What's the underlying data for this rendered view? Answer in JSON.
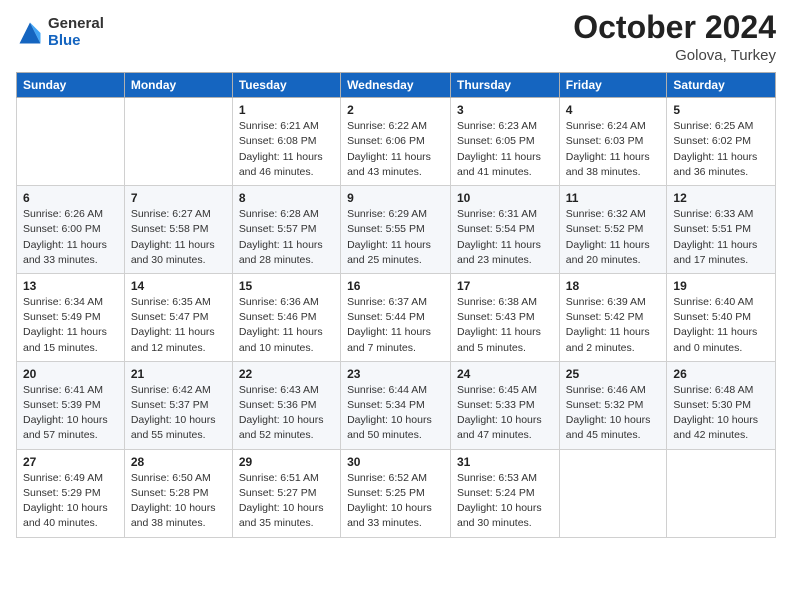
{
  "header": {
    "logo_general": "General",
    "logo_blue": "Blue",
    "month_title": "October 2024",
    "location": "Golova, Turkey"
  },
  "days_of_week": [
    "Sunday",
    "Monday",
    "Tuesday",
    "Wednesday",
    "Thursday",
    "Friday",
    "Saturday"
  ],
  "weeks": [
    [
      {
        "day": "",
        "info": ""
      },
      {
        "day": "",
        "info": ""
      },
      {
        "day": "1",
        "info": "Sunrise: 6:21 AM\nSunset: 6:08 PM\nDaylight: 11 hours and 46 minutes."
      },
      {
        "day": "2",
        "info": "Sunrise: 6:22 AM\nSunset: 6:06 PM\nDaylight: 11 hours and 43 minutes."
      },
      {
        "day": "3",
        "info": "Sunrise: 6:23 AM\nSunset: 6:05 PM\nDaylight: 11 hours and 41 minutes."
      },
      {
        "day": "4",
        "info": "Sunrise: 6:24 AM\nSunset: 6:03 PM\nDaylight: 11 hours and 38 minutes."
      },
      {
        "day": "5",
        "info": "Sunrise: 6:25 AM\nSunset: 6:02 PM\nDaylight: 11 hours and 36 minutes."
      }
    ],
    [
      {
        "day": "6",
        "info": "Sunrise: 6:26 AM\nSunset: 6:00 PM\nDaylight: 11 hours and 33 minutes."
      },
      {
        "day": "7",
        "info": "Sunrise: 6:27 AM\nSunset: 5:58 PM\nDaylight: 11 hours and 30 minutes."
      },
      {
        "day": "8",
        "info": "Sunrise: 6:28 AM\nSunset: 5:57 PM\nDaylight: 11 hours and 28 minutes."
      },
      {
        "day": "9",
        "info": "Sunrise: 6:29 AM\nSunset: 5:55 PM\nDaylight: 11 hours and 25 minutes."
      },
      {
        "day": "10",
        "info": "Sunrise: 6:31 AM\nSunset: 5:54 PM\nDaylight: 11 hours and 23 minutes."
      },
      {
        "day": "11",
        "info": "Sunrise: 6:32 AM\nSunset: 5:52 PM\nDaylight: 11 hours and 20 minutes."
      },
      {
        "day": "12",
        "info": "Sunrise: 6:33 AM\nSunset: 5:51 PM\nDaylight: 11 hours and 17 minutes."
      }
    ],
    [
      {
        "day": "13",
        "info": "Sunrise: 6:34 AM\nSunset: 5:49 PM\nDaylight: 11 hours and 15 minutes."
      },
      {
        "day": "14",
        "info": "Sunrise: 6:35 AM\nSunset: 5:47 PM\nDaylight: 11 hours and 12 minutes."
      },
      {
        "day": "15",
        "info": "Sunrise: 6:36 AM\nSunset: 5:46 PM\nDaylight: 11 hours and 10 minutes."
      },
      {
        "day": "16",
        "info": "Sunrise: 6:37 AM\nSunset: 5:44 PM\nDaylight: 11 hours and 7 minutes."
      },
      {
        "day": "17",
        "info": "Sunrise: 6:38 AM\nSunset: 5:43 PM\nDaylight: 11 hours and 5 minutes."
      },
      {
        "day": "18",
        "info": "Sunrise: 6:39 AM\nSunset: 5:42 PM\nDaylight: 11 hours and 2 minutes."
      },
      {
        "day": "19",
        "info": "Sunrise: 6:40 AM\nSunset: 5:40 PM\nDaylight: 11 hours and 0 minutes."
      }
    ],
    [
      {
        "day": "20",
        "info": "Sunrise: 6:41 AM\nSunset: 5:39 PM\nDaylight: 10 hours and 57 minutes."
      },
      {
        "day": "21",
        "info": "Sunrise: 6:42 AM\nSunset: 5:37 PM\nDaylight: 10 hours and 55 minutes."
      },
      {
        "day": "22",
        "info": "Sunrise: 6:43 AM\nSunset: 5:36 PM\nDaylight: 10 hours and 52 minutes."
      },
      {
        "day": "23",
        "info": "Sunrise: 6:44 AM\nSunset: 5:34 PM\nDaylight: 10 hours and 50 minutes."
      },
      {
        "day": "24",
        "info": "Sunrise: 6:45 AM\nSunset: 5:33 PM\nDaylight: 10 hours and 47 minutes."
      },
      {
        "day": "25",
        "info": "Sunrise: 6:46 AM\nSunset: 5:32 PM\nDaylight: 10 hours and 45 minutes."
      },
      {
        "day": "26",
        "info": "Sunrise: 6:48 AM\nSunset: 5:30 PM\nDaylight: 10 hours and 42 minutes."
      }
    ],
    [
      {
        "day": "27",
        "info": "Sunrise: 6:49 AM\nSunset: 5:29 PM\nDaylight: 10 hours and 40 minutes."
      },
      {
        "day": "28",
        "info": "Sunrise: 6:50 AM\nSunset: 5:28 PM\nDaylight: 10 hours and 38 minutes."
      },
      {
        "day": "29",
        "info": "Sunrise: 6:51 AM\nSunset: 5:27 PM\nDaylight: 10 hours and 35 minutes."
      },
      {
        "day": "30",
        "info": "Sunrise: 6:52 AM\nSunset: 5:25 PM\nDaylight: 10 hours and 33 minutes."
      },
      {
        "day": "31",
        "info": "Sunrise: 6:53 AM\nSunset: 5:24 PM\nDaylight: 10 hours and 30 minutes."
      },
      {
        "day": "",
        "info": ""
      },
      {
        "day": "",
        "info": ""
      }
    ]
  ]
}
